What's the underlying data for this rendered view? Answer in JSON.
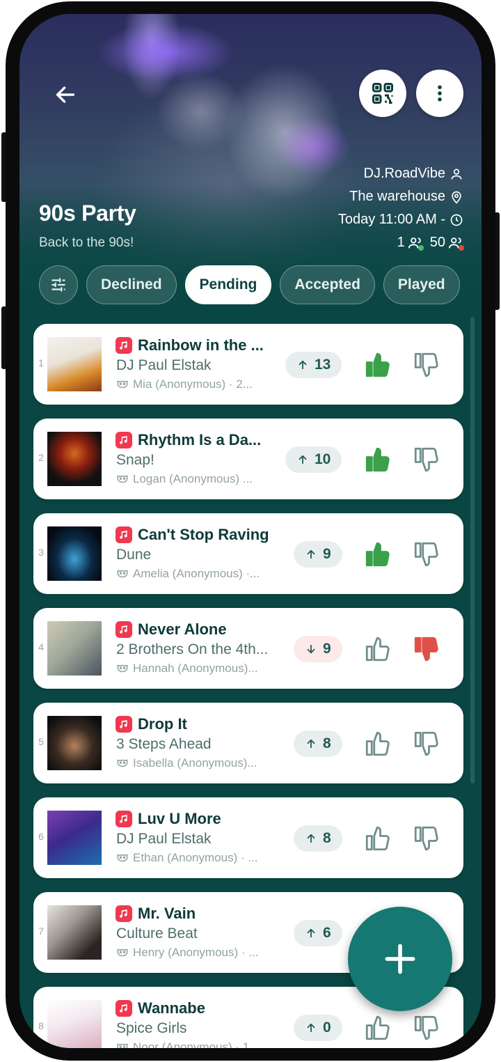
{
  "event": {
    "title": "90s Party",
    "subtitle": "Back to the 90s!",
    "dj": "DJ.RoadVibe",
    "venue": "The warehouse",
    "time": "Today 11:00 AM -",
    "online_count": "1",
    "total_count": "50"
  },
  "colors": {
    "brand": "#0a4744",
    "accent": "#167872",
    "upvote_active": "#3aa04a",
    "downvote_active": "#e05048",
    "music_badge": "#f0384f"
  },
  "filters": [
    {
      "label": "Declined",
      "active": false
    },
    {
      "label": "Pending",
      "active": true
    },
    {
      "label": "Accepted",
      "active": false
    },
    {
      "label": "Played",
      "active": false
    }
  ],
  "songs": [
    {
      "rank": "1",
      "title": "Rainbow in the ...",
      "artist": "DJ Paul Elstak",
      "requester": "Mia (Anonymous) · 2...",
      "votes": "13",
      "direction": "up",
      "liked": true,
      "disliked": false
    },
    {
      "rank": "2",
      "title": "Rhythm Is a Da...",
      "artist": "Snap!",
      "requester": "Logan (Anonymous) ...",
      "votes": "10",
      "direction": "up",
      "liked": true,
      "disliked": false
    },
    {
      "rank": "3",
      "title": "Can't Stop Raving",
      "artist": "Dune",
      "requester": "Amelia (Anonymous) ·...",
      "votes": "9",
      "direction": "up",
      "liked": true,
      "disliked": false
    },
    {
      "rank": "4",
      "title": "Never Alone",
      "artist": "2 Brothers On the 4th...",
      "requester": "Hannah (Anonymous)...",
      "votes": "9",
      "direction": "down",
      "liked": false,
      "disliked": true
    },
    {
      "rank": "5",
      "title": "Drop It",
      "artist": "3 Steps Ahead",
      "requester": "Isabella (Anonymous)...",
      "votes": "8",
      "direction": "up",
      "liked": false,
      "disliked": false
    },
    {
      "rank": "6",
      "title": "Luv U More",
      "artist": "DJ Paul Elstak",
      "requester": "Ethan (Anonymous) · ...",
      "votes": "8",
      "direction": "up",
      "liked": false,
      "disliked": false
    },
    {
      "rank": "7",
      "title": "Mr. Vain",
      "artist": "Culture Beat",
      "requester": "Henry (Anonymous) · ...",
      "votes": "6",
      "direction": "up",
      "liked": false,
      "disliked": false
    },
    {
      "rank": "8",
      "title": "Wannabe",
      "artist": "Spice Girls",
      "requester": "Noor (Anonymous) · 1",
      "votes": "0",
      "direction": "up",
      "liked": false,
      "disliked": false
    }
  ],
  "icons": {
    "back": "arrow-left-icon",
    "qr": "qr-code-icon",
    "menu": "more-vertical-icon",
    "filter": "sliders-icon",
    "add": "plus-icon"
  }
}
